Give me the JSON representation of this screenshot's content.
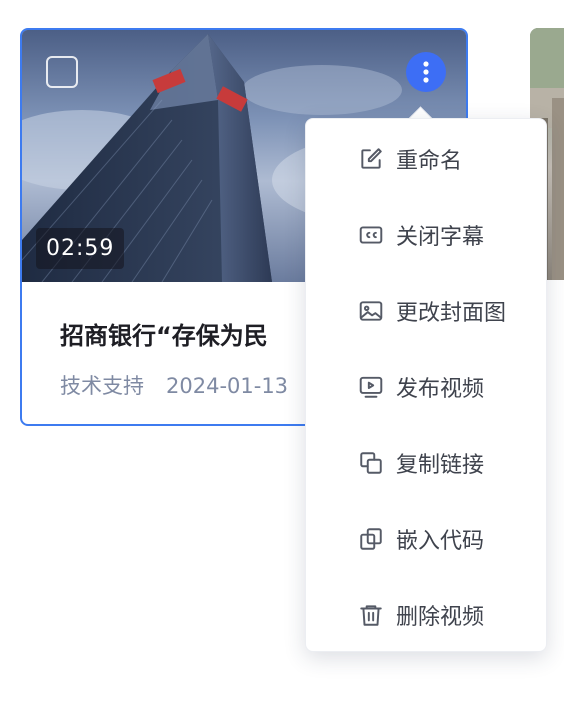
{
  "video_card": {
    "duration": "02:59",
    "title": "招商银行“存保为民",
    "author": "技术支持",
    "date": "2024-01-13",
    "selected_border_color": "#3d7bf0",
    "more_button_color": "#3d6ef5"
  },
  "context_menu": {
    "items": [
      {
        "label": "重命名",
        "icon": "edit-icon"
      },
      {
        "label": "关闭字幕",
        "icon": "closed-captions-icon"
      },
      {
        "label": "更改封面图",
        "icon": "image-icon"
      },
      {
        "label": "发布视频",
        "icon": "play-screen-icon"
      },
      {
        "label": "复制链接",
        "icon": "copy-icon"
      },
      {
        "label": "嵌入代码",
        "icon": "embed-icon"
      },
      {
        "label": "删除视频",
        "icon": "trash-icon"
      }
    ]
  }
}
